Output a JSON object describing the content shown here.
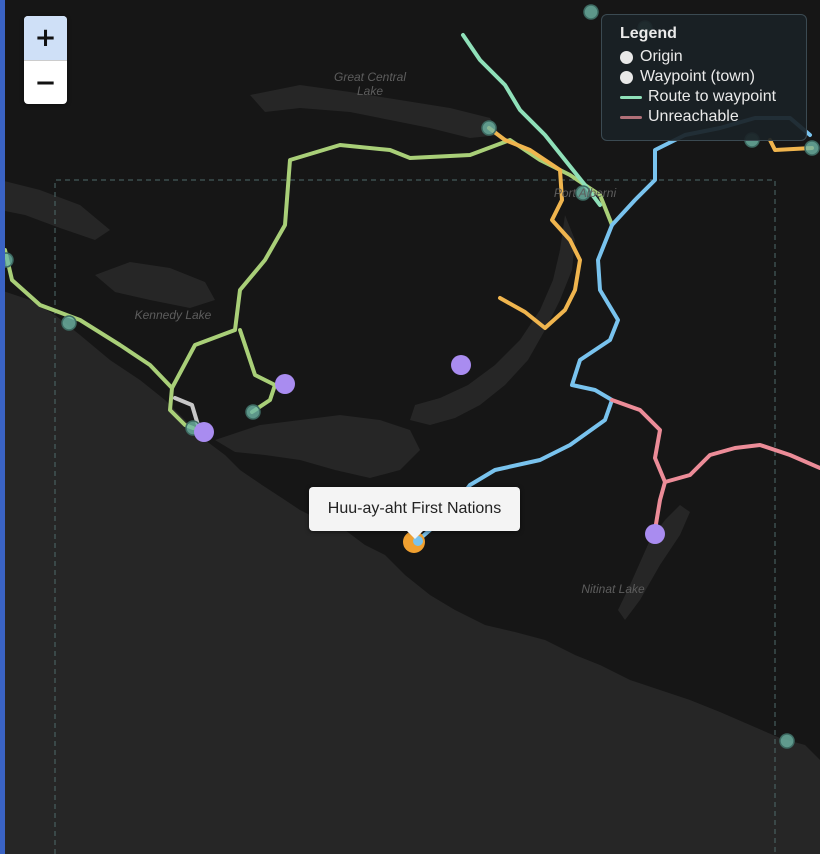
{
  "zoom": {
    "in_label": "+",
    "out_label": "−"
  },
  "legend": {
    "title": "Legend",
    "items": [
      {
        "label": "Origin"
      },
      {
        "label": "Waypoint (town)"
      },
      {
        "label": "Route to waypoint"
      },
      {
        "label": "Unreachable"
      }
    ]
  },
  "tooltip": {
    "text": "Huu-ay-aht First Nations"
  },
  "places": {
    "great_central_line1": "Great Central",
    "great_central_line2": "Lake",
    "kennedy": "Kennedy Lake",
    "port_alberni": "Port Alberni",
    "nitinat": "Nitinat Lake"
  },
  "colors": {
    "land": "#161616",
    "water": "#262626",
    "route_green": "#a9cf78",
    "route_mint": "#8fe0b9",
    "route_orange": "#f0b54e",
    "route_blue": "#79c3ee",
    "unreachable": "#ec8c98",
    "waypoint": "#6fb8a8",
    "origin": "#a98cf0",
    "selected": "#f0a030"
  }
}
